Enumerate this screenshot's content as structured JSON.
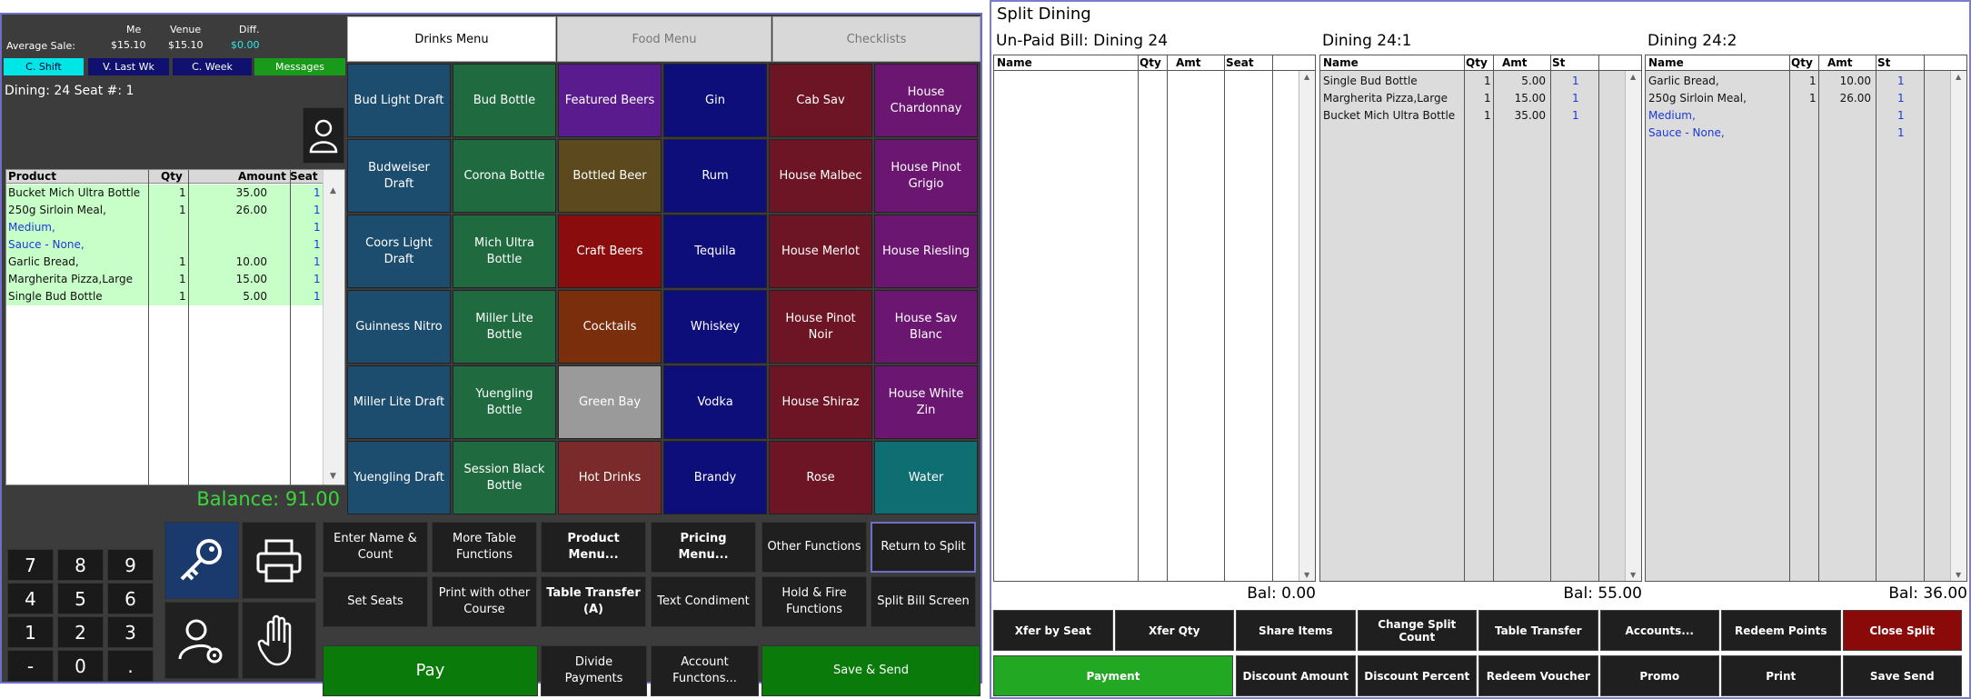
{
  "info": {
    "me_label": "Me",
    "venue_label": "Venue",
    "diff_label": "Diff.",
    "avg_label": "Average Sale:",
    "me_value": "$15.10",
    "venue_value": "$15.10",
    "diff_value": "$0.00",
    "buttons": [
      "C. Shift",
      "V. Last Wk",
      "C. Week",
      "Messages"
    ],
    "table_text": "Dining: 24  Seat #: 1"
  },
  "products": {
    "headers": [
      "Product",
      "Qty",
      "Amount",
      "Seat"
    ],
    "rows": [
      {
        "name": "Bucket Mich Ultra Bottle",
        "qty": "1",
        "amt": "35.00",
        "seat": "1",
        "mod": false
      },
      {
        "name": "250g Sirloin Meal,",
        "qty": "1",
        "amt": "26.00",
        "seat": "1",
        "mod": false
      },
      {
        "name": " Medium,",
        "qty": "",
        "amt": "",
        "seat": "1",
        "mod": true
      },
      {
        "name": " Sauce - None,",
        "qty": "",
        "amt": "",
        "seat": "1",
        "mod": true
      },
      {
        "name": "Garlic Bread,",
        "qty": "1",
        "amt": "10.00",
        "seat": "1",
        "mod": false
      },
      {
        "name": "Margherita Pizza,Large",
        "qty": "1",
        "amt": "15.00",
        "seat": "1",
        "mod": false
      },
      {
        "name": "Single Bud Bottle",
        "qty": "1",
        "amt": "5.00",
        "seat": "1",
        "mod": false
      }
    ]
  },
  "balance": "Balance: 91.00",
  "tabs": [
    "Drinks Menu",
    "Food Menu",
    "Checklists"
  ],
  "menu_columns": [
    {
      "color": "#1d4d6e",
      "items": [
        "Bud Light Draft",
        "Budweiser Draft",
        "Coors Light Draft",
        "Guinness Nitro",
        "Miller Lite Draft",
        "Yuengling Draft"
      ]
    },
    {
      "color": "#1f6b3f",
      "items": [
        "Bud Bottle",
        "Corona Bottle",
        "Mich Ultra Bottle",
        "Miller Lite Bottle",
        "Yuengling Bottle",
        "Session Black Bottle"
      ]
    },
    {
      "color": "#5c1a8c",
      "items": [
        "Featured Beers",
        "Bottled Beer",
        "Craft Beers",
        "Cocktails",
        "Green Bay",
        "Hot Drinks"
      ],
      "colors": [
        "#5a1b8e",
        "#5c4a1e",
        "#8a0c0c",
        "#7a2e0c",
        "#9a9a9a",
        "#7a2a2a"
      ]
    },
    {
      "color": "#0e0e7a",
      "items": [
        "Gin",
        "Rum",
        "Tequila",
        "Whiskey",
        "Vodka",
        "Brandy"
      ]
    },
    {
      "color": "#6e1525",
      "items": [
        "Cab Sav",
        "House Malbec",
        "House Merlot",
        "House Pinot Noir",
        "House Shiraz",
        "Rose"
      ]
    },
    {
      "color": "#6b1670",
      "items": [
        "House Chardonnay",
        "House Pinot Grigio",
        "House Riesling",
        "House Sav Blanc",
        "House White Zin",
        "Water"
      ],
      "colors": [
        "#6b1670",
        "#6b1670",
        "#6b1670",
        "#6b1670",
        "#6b1670",
        "#0e6e72"
      ]
    }
  ],
  "keypad": [
    "7",
    "8",
    "9",
    "4",
    "5",
    "6",
    "1",
    "2",
    "3",
    "-",
    "0",
    "."
  ],
  "functions": {
    "row1": [
      "Enter Name & Count",
      "More Table Functions",
      "Product Menu...",
      "Pricing Menu...",
      "Other Functions",
      "Return to Split"
    ],
    "row2": [
      "Set Seats",
      "Print with other Course",
      "Table Transfer (A)",
      "Text Condiment",
      "Hold & Fire Functions",
      "Split Bill Screen"
    ],
    "pay": "Pay",
    "divide": "Divide Payments",
    "account": "Account Functons...",
    "save_send": "Save & Send"
  },
  "split": {
    "title": "Split Dining",
    "cols": [
      {
        "title": "Un-Paid Bill: Dining 24",
        "headers": [
          "Name",
          "Qty",
          "Amt",
          "Seat"
        ],
        "rows": [],
        "bal": "Bal: 0.00"
      },
      {
        "title": "Dining 24:1",
        "headers": [
          "Name",
          "Qty",
          "Amt",
          "St"
        ],
        "rows": [
          {
            "name": "Single Bud Bottle",
            "qty": "1",
            "amt": "5.00",
            "st": "1",
            "mod": false
          },
          {
            "name": "Margherita Pizza,Large",
            "qty": "1",
            "amt": "15.00",
            "st": "1",
            "mod": false
          },
          {
            "name": "Bucket Mich Ultra Bottle",
            "qty": "1",
            "amt": "35.00",
            "st": "1",
            "mod": false
          }
        ],
        "bal": "Bal: 55.00"
      },
      {
        "title": "Dining 24:2",
        "headers": [
          "Name",
          "Qty",
          "Amt",
          "St"
        ],
        "rows": [
          {
            "name": "Garlic Bread,",
            "qty": "1",
            "amt": "10.00",
            "st": "1",
            "mod": false
          },
          {
            "name": "250g Sirloin Meal,",
            "qty": "1",
            "amt": "26.00",
            "st": "1",
            "mod": false
          },
          {
            "name": " Medium,",
            "qty": "",
            "amt": "",
            "st": "1",
            "mod": true
          },
          {
            "name": " Sauce - None,",
            "qty": "",
            "amt": "",
            "st": "1",
            "mod": true
          }
        ],
        "bal": "Bal: 36.00"
      }
    ],
    "buttons_row1": [
      "Xfer by Seat",
      "Xfer Qty",
      "Share Items",
      "Change Split Count",
      "Table Transfer",
      "Accounts...",
      "Redeem Points",
      "Close Split"
    ],
    "buttons_row2": [
      "Payment",
      "Discount Amount",
      "Discount Percent",
      "Redeem Voucher",
      "Promo",
      "Print",
      "Save Send"
    ]
  },
  "colors": {
    "accent_green": "#3bd63b",
    "pay_green": "#0a7a0a",
    "payment_green": "#22a822",
    "close_red": "#8a0a0a",
    "cyan": "#00e5e5"
  }
}
